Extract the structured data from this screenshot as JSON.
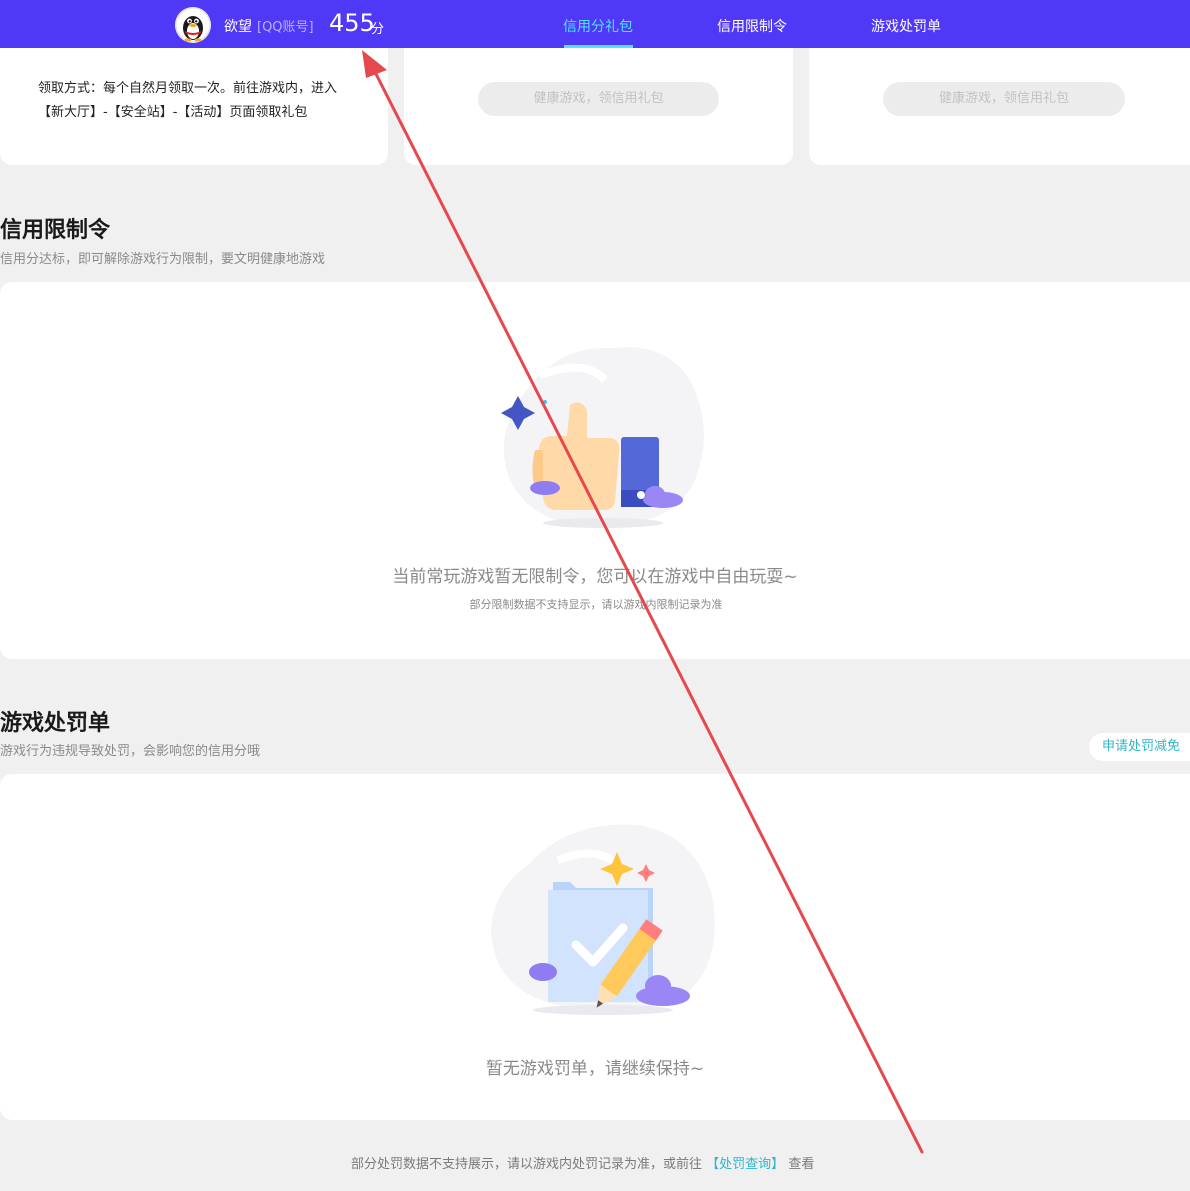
{
  "header": {
    "nickname": "欲望",
    "account_label": "[QQ账号]",
    "score": "455",
    "score_unit": "分",
    "nav": [
      {
        "label": "信用分礼包",
        "active": true
      },
      {
        "label": "信用限制令",
        "active": false
      },
      {
        "label": "游戏处罚单",
        "active": false
      }
    ]
  },
  "gift_section": {
    "claim_text": "领取方式：每个自然月领取一次。前往游戏内，进入【新大厅】-【安全站】-【活动】页面领取礼包",
    "buttons": [
      "健康游戏，领信用礼包",
      "健康游戏，领信用礼包"
    ]
  },
  "restriction_section": {
    "title": "信用限制令",
    "subtitle": "信用分达标，即可解除游戏行为限制，要文明健康地游戏",
    "empty_message": "当前常玩游戏暂无限制令，您可以在游戏中自由玩耍~",
    "note": "部分限制数据不支持显示，请以游戏内限制记录为准"
  },
  "penalty_section": {
    "title": "游戏处罚单",
    "subtitle": "游戏行为违规导致处罚，会影响您的信用分哦",
    "appeal_button": "申请处罚减免",
    "empty_message": "暂无游戏罚单，请继续保持~"
  },
  "footer": {
    "note_before": "部分处罚数据不支持展示，请以游戏内处罚记录为准，或前往",
    "link": "【处罚查询】",
    "note_after": "查看"
  },
  "colors": {
    "header_bg": "#5039f6",
    "nav_active": "#4fe3ff",
    "link": "#2fb6c8",
    "annotation_arrow": "#e5484d"
  },
  "icons": [
    "qq-penguin-avatar-icon",
    "thumbs-up-illustration",
    "checked-document-pencil-illustration"
  ]
}
